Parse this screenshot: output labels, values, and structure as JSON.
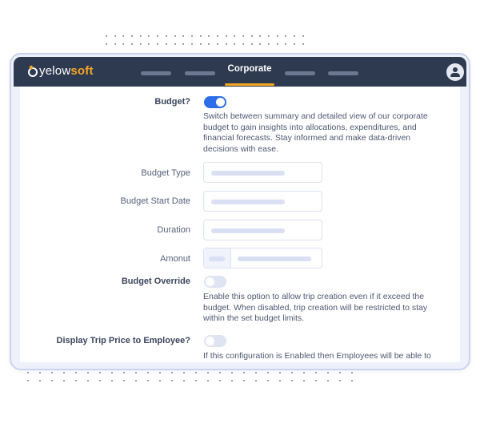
{
  "header": {
    "logo": {
      "prefix": "yelow",
      "accent": "soft"
    },
    "active_tab": "Corporate"
  },
  "settings": {
    "budget": {
      "label": "Budget?",
      "enabled": true,
      "description": "Switch between summary and detailed view of our corporate budget to gain insights into allocations, expenditures, and financial forecasts. Stay informed and make data-driven decisions with ease."
    },
    "fields": [
      {
        "label": "Budget Type"
      },
      {
        "label": "Budget Start Date"
      },
      {
        "label": "Duration"
      },
      {
        "label": "Amonut"
      }
    ],
    "budget_override": {
      "label": "Budget Override",
      "enabled": false,
      "description": "Enable this option to allow trip creation even if it exceed the budget. When disabled, trip creation will be restricted to stay within the set budget limits."
    },
    "display_trip_price": {
      "label": "Display Trip Price to Employee?",
      "enabled": false,
      "description": "If this configuration is Enabled then Employees will be able to"
    }
  },
  "colors": {
    "header_bg": "#2d3a50",
    "accent": "#f5a623",
    "toggle_on": "#2d6ee8",
    "toggle_off": "#dfe4f2"
  }
}
